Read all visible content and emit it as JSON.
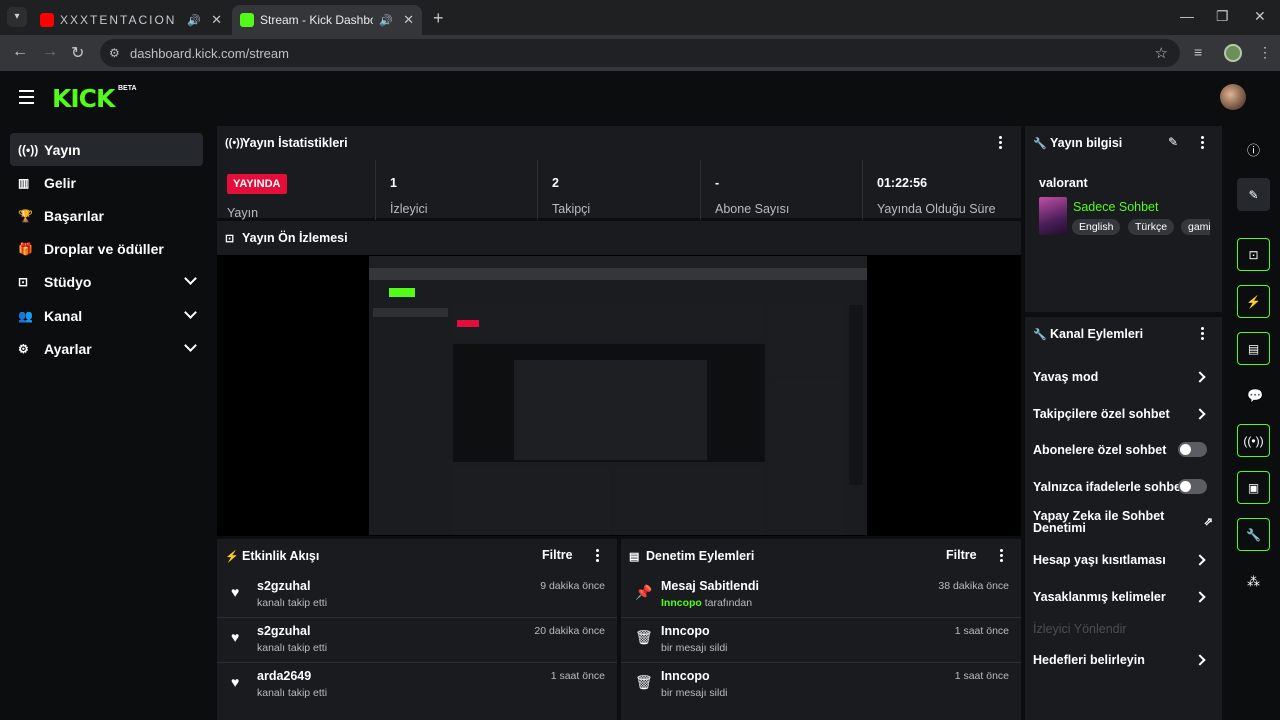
{
  "browser": {
    "tabs": [
      {
        "title": "XXXTENTACION Gre",
        "favicon": "youtube-icon"
      },
      {
        "title": "Stream - Kick Dashboard",
        "favicon": "kick-icon"
      }
    ],
    "url": "dashboard.kick.com/stream"
  },
  "header": {
    "logo": "KICK",
    "beta": "BETA"
  },
  "sidebar": {
    "items": [
      {
        "label": "Yayın",
        "icon": "broadcast-icon"
      },
      {
        "label": "Gelir",
        "icon": "chart-icon"
      },
      {
        "label": "Başarılar",
        "icon": "trophy-icon"
      },
      {
        "label": "Droplar ve ödüller",
        "icon": "gift-icon"
      },
      {
        "label": "Stüdyo",
        "icon": "studio-icon"
      },
      {
        "label": "Kanal",
        "icon": "people-icon"
      },
      {
        "label": "Ayarlar",
        "icon": "gear-icon"
      }
    ]
  },
  "stats": {
    "title": "Yayın İstatistikleri",
    "live_badge": "YAYINDA",
    "live_label": "Yayın",
    "viewers": {
      "value": "1",
      "label": "İzleyici"
    },
    "followers": {
      "value": "2",
      "label": "Takipçi"
    },
    "subs": {
      "value": "-",
      "label": "Abone Sayısı"
    },
    "uptime": {
      "value": "01:22:56",
      "label": "Yayında Olduğu Süre"
    }
  },
  "preview": {
    "title": "Yayın Ön İzlemesi"
  },
  "activity": {
    "title": "Etkinlik Akışı",
    "filter": "Filtre",
    "rows": [
      {
        "name": "s2gzuhal",
        "action": "kanalı takip etti",
        "time": "9 dakika önce"
      },
      {
        "name": "s2gzuhal",
        "action": "kanalı takip etti",
        "time": "20 dakika önce"
      },
      {
        "name": "arda2649",
        "action": "kanalı takip etti",
        "time": "1 saat önce"
      }
    ]
  },
  "moderation": {
    "title": "Denetim Eylemleri",
    "filter": "Filtre",
    "rows": [
      {
        "name": "Mesaj Sabitlendi",
        "actor": "Inncopo",
        "action": "tarafından",
        "time": "38 dakika önce"
      },
      {
        "name": "Inncopo",
        "action": "bir mesajı sildi",
        "time": "1 saat önce"
      },
      {
        "name": "Inncopo",
        "action": "bir mesajı sildi",
        "time": "1 saat önce"
      }
    ]
  },
  "stream_info": {
    "title": "Yayın bilgisi",
    "category": "valorant",
    "stream_title": "Sadece Sohbet",
    "tags": [
      "English",
      "Türkçe",
      "gami"
    ]
  },
  "channel_actions": {
    "title": "Kanal Eylemleri",
    "items": [
      {
        "label": "Yavaş mod",
        "control": "arrow"
      },
      {
        "label": "Takipçilere özel sohbet",
        "control": "arrow"
      },
      {
        "label": "Abonelere özel sohbet",
        "control": "toggle"
      },
      {
        "label": "Yalnızca ifadelerle sohbet",
        "control": "toggle"
      },
      {
        "label": "Yapay Zeka ile Sohbet Denetimi",
        "control": "external"
      },
      {
        "label": "Hesap yaşı kısıtlaması",
        "control": "arrow"
      },
      {
        "label": "Yasaklanmış kelimeler",
        "control": "arrow"
      },
      {
        "label": "İzleyici Yönlendir",
        "control": "none"
      },
      {
        "label": "Hedefleri belirleyin",
        "control": "arrow"
      }
    ]
  },
  "colors": {
    "accent": "#53fc18",
    "live": "#e50d3a",
    "panel": "#191b1f",
    "background": "#0b0d0e"
  }
}
